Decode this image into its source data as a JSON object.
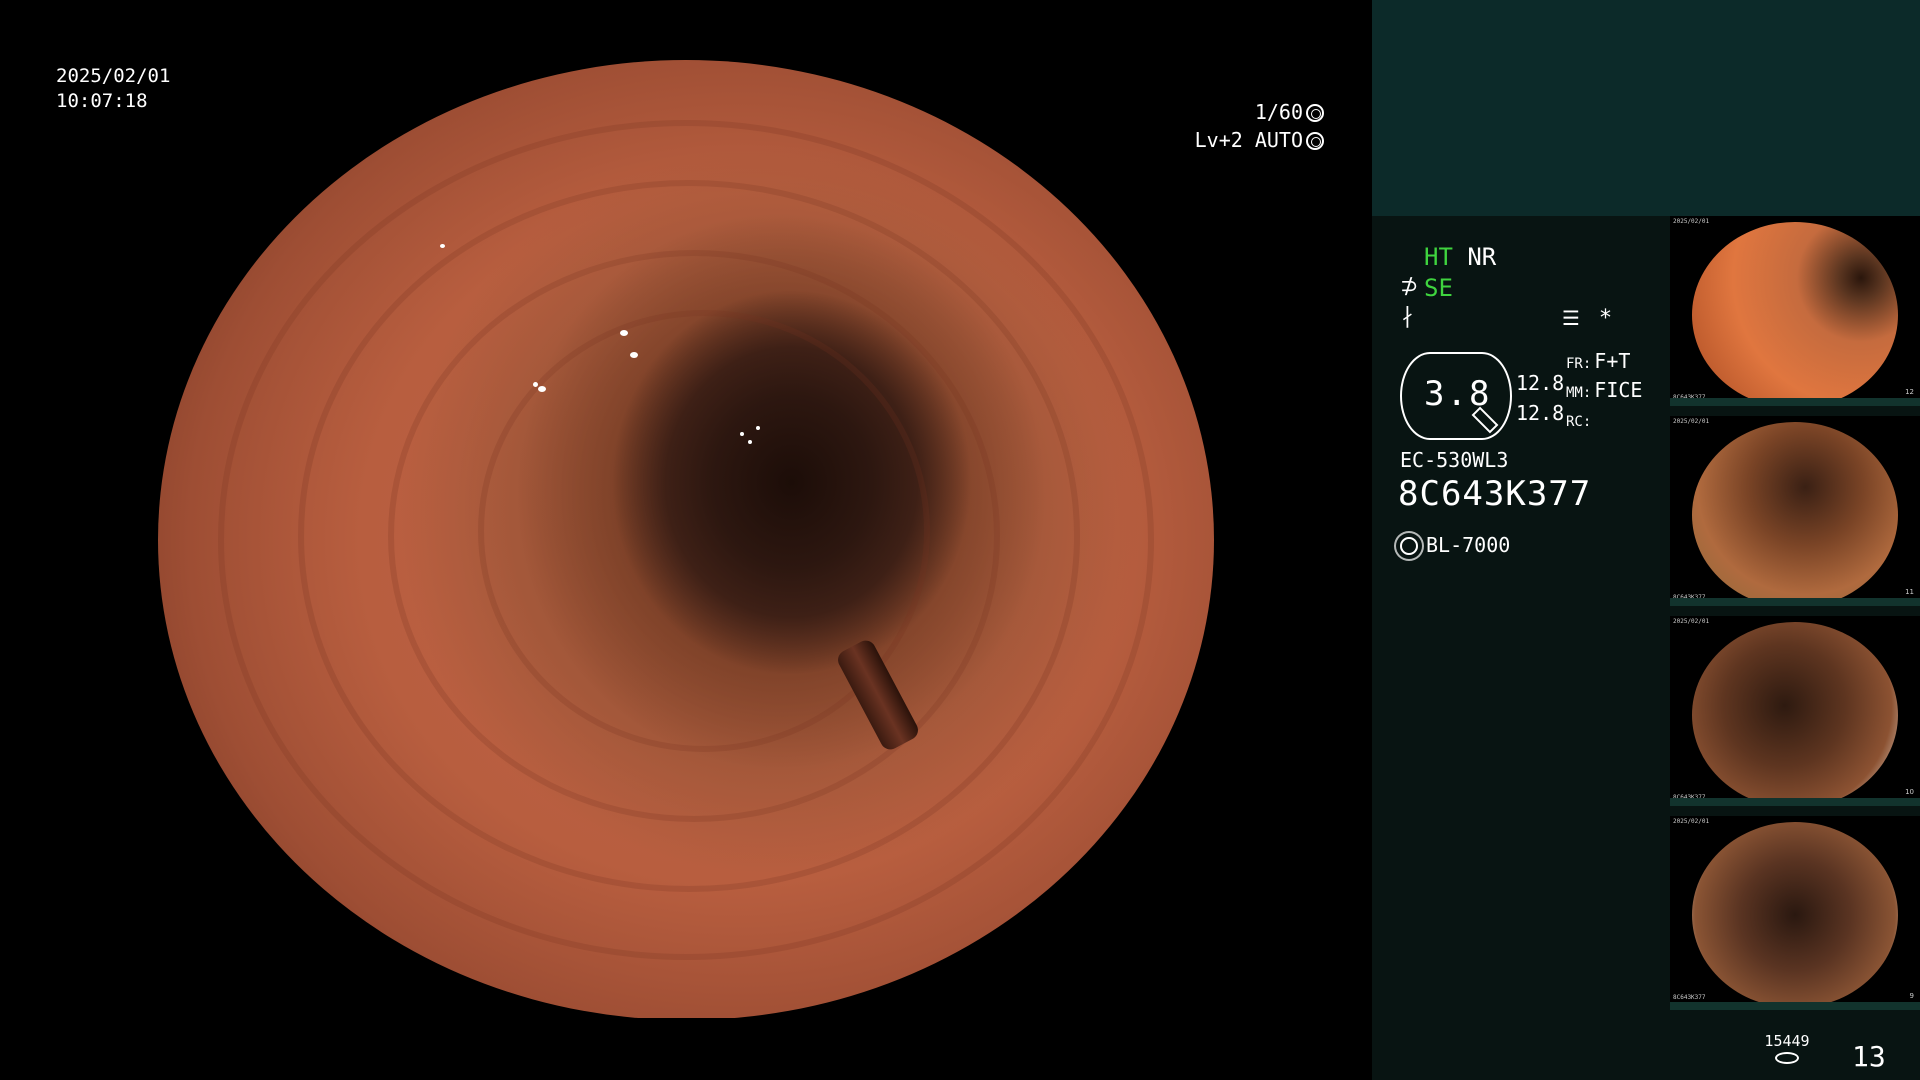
{
  "overlay": {
    "date": "2025/02/01",
    "time": "10:07:18",
    "shutter": "1/60",
    "iris": "Lv+2 AUTO"
  },
  "panel": {
    "mode_ht": "HT",
    "mode_nr": "NR",
    "mode_se": "SE",
    "asterisk": "*",
    "zoom_value": "3.8",
    "param_values": [
      "12.8",
      "12.8"
    ],
    "fr_label": "FR:",
    "fr_value": "F+T",
    "mm_label": "MM:",
    "mm_value": "FICE",
    "rc_label": "RC:",
    "scope_model": "EC-530WL3",
    "scope_serial": "8C643K377",
    "light_source": "BL-7000",
    "storage_count": "15449",
    "image_counter": "13"
  },
  "colors": {
    "accent_green": "#3fd43f",
    "panel_bg": "#081412",
    "panel_top": "#0c2a29"
  },
  "thumbnails": [
    {
      "label": "captured-image-1",
      "num": "12",
      "serial": "8C643K377"
    },
    {
      "label": "captured-image-2",
      "num": "11",
      "serial": "8C643K377"
    },
    {
      "label": "captured-image-3",
      "num": "10",
      "serial": "8C643K377"
    },
    {
      "label": "captured-image-4",
      "num": "9",
      "serial": "8C643K377"
    }
  ]
}
